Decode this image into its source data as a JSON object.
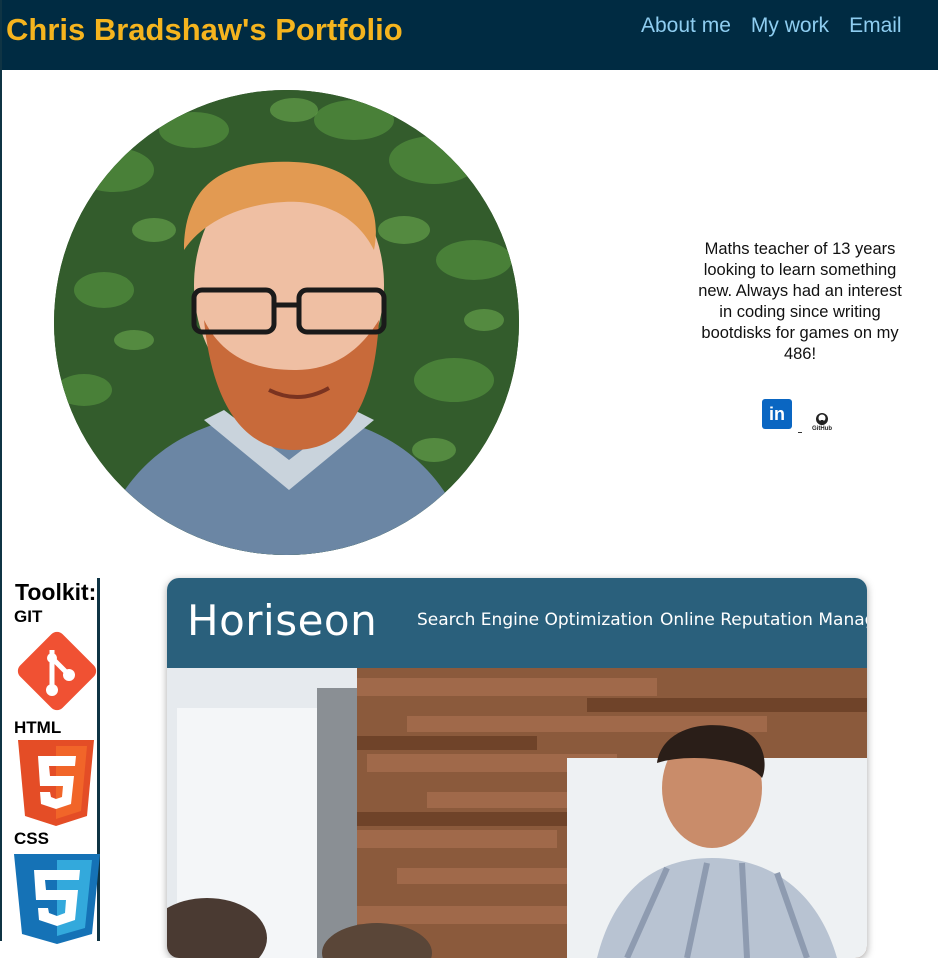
{
  "header": {
    "title": "Chris Bradshaw's Portfolio",
    "nav": [
      "About me",
      "My work",
      "Email"
    ]
  },
  "about": {
    "bio": "Maths teacher of 13 years looking to learn something new. Always had an interest in coding since writing bootdisks for games on my 486!",
    "socials": {
      "linkedin_glyph": "in",
      "github_caption": "GitHub"
    }
  },
  "toolkit": {
    "title": "Toolkit:",
    "tools": [
      "GIT",
      "HTML",
      "CSS"
    ]
  },
  "project": {
    "brand": "Horiseon",
    "nav": [
      "Search Engine Optimization",
      "Online Reputation Manage"
    ]
  },
  "colors": {
    "header_bg": "#002b42",
    "title": "#f5b41e",
    "nav_link": "#8ecdf0",
    "project_nav": "#2a607c"
  },
  "icons": [
    "linkedin-icon",
    "github-icon",
    "git-logo",
    "html5-logo",
    "css3-logo"
  ]
}
